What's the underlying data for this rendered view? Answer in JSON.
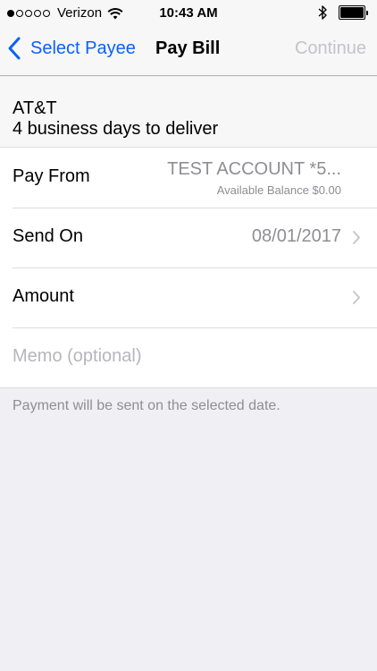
{
  "status_bar": {
    "carrier": "Verizon",
    "time": "10:43 AM",
    "signal_bars_filled": 1,
    "signal_bars_total": 5,
    "battery_level": 1.0
  },
  "nav": {
    "back_label": "Select Payee",
    "title": "Pay Bill",
    "continue_label": "Continue"
  },
  "payee": {
    "name": "AT&T",
    "delivery": "4 business days to deliver"
  },
  "form": {
    "pay_from": {
      "label": "Pay From",
      "account": "TEST ACCOUNT *5...",
      "balance": "Available Balance $0.00"
    },
    "send_on": {
      "label": "Send On",
      "value": "08/01/2017"
    },
    "amount": {
      "label": "Amount",
      "value": ""
    },
    "memo": {
      "placeholder": "Memo (optional)"
    }
  },
  "footer_note": "Payment will be sent on the selected date.",
  "colors": {
    "accent": "#0a60ff",
    "background": "#efeff4",
    "secondary_text": "#8e8e93",
    "disabled": "#c4c4c8"
  }
}
